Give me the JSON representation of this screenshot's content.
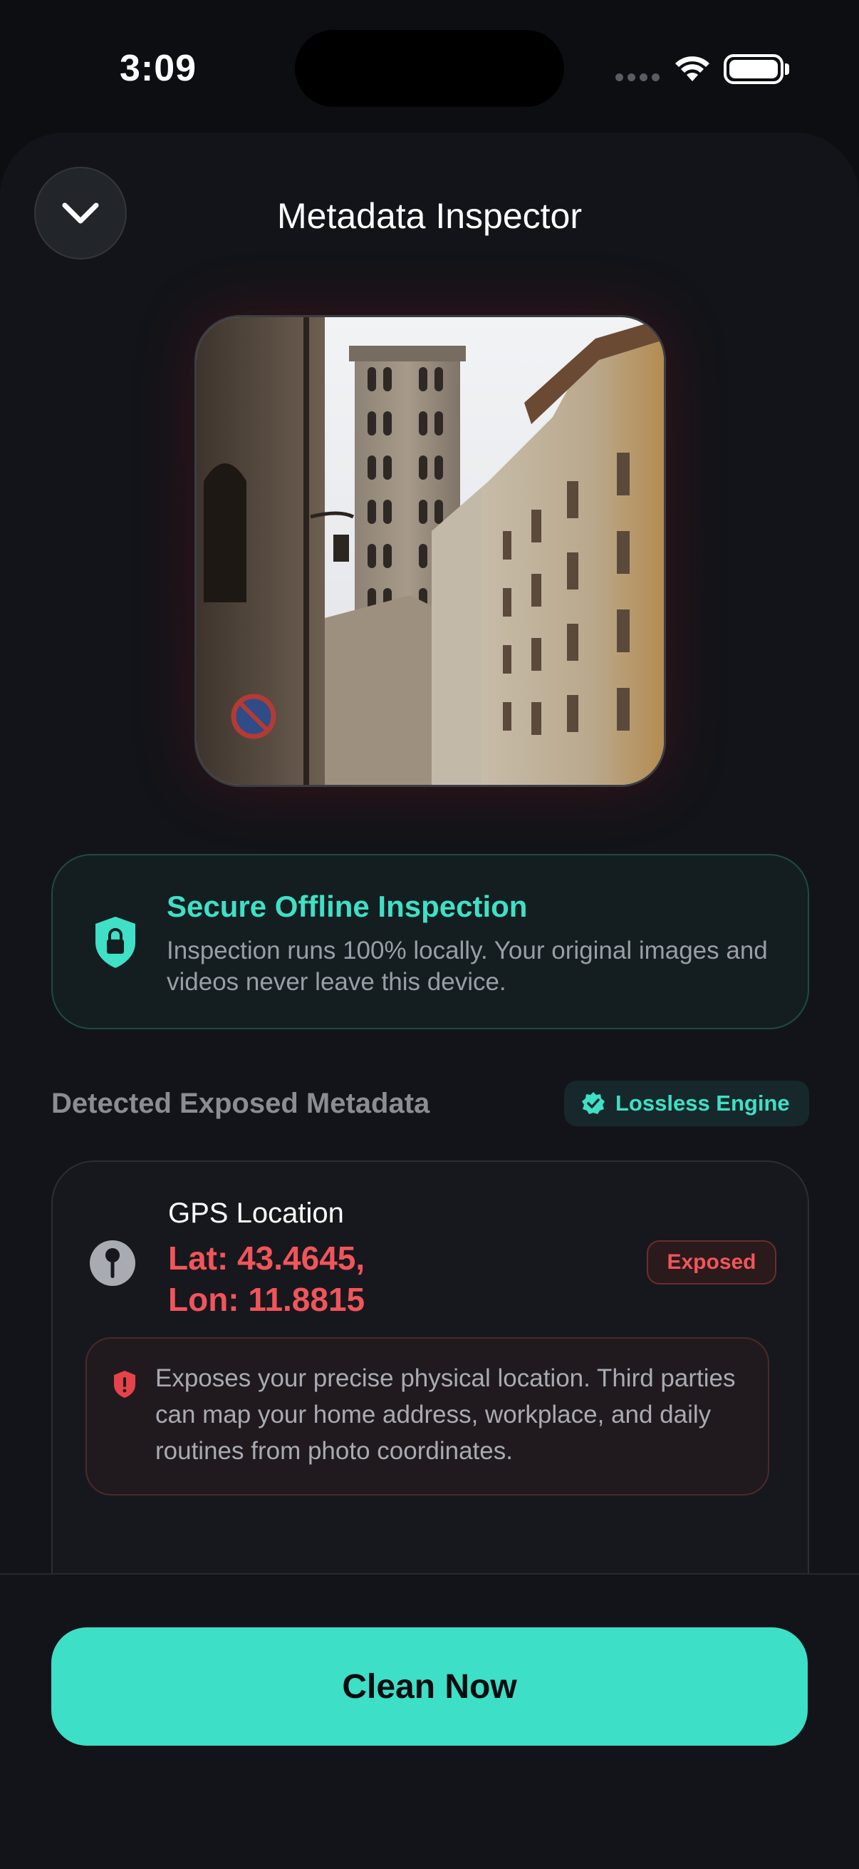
{
  "status_bar": {
    "time": "3:09"
  },
  "sheet": {
    "title": "Metadata Inspector"
  },
  "secure_card": {
    "title": "Secure Offline Inspection",
    "body": "Inspection runs 100% locally. Your original images and videos never leave this device."
  },
  "section": {
    "title": "Detected Exposed Metadata",
    "badge_label": "Lossless Engine"
  },
  "metadata_items": [
    {
      "label": "GPS Location",
      "value_line1": "Lat: 43.4645,",
      "value_line2": "Lon: 11.8815",
      "status": "Exposed",
      "warning": "Exposes your precise physical location. Third parties can map your home address, workplace, and daily routines from photo coordinates.",
      "icon": "pin-icon"
    }
  ],
  "actions": {
    "clean_label": "Clean Now"
  },
  "colors": {
    "accent": "#3ddfc6",
    "danger": "#f1555a",
    "background": "#131419"
  }
}
